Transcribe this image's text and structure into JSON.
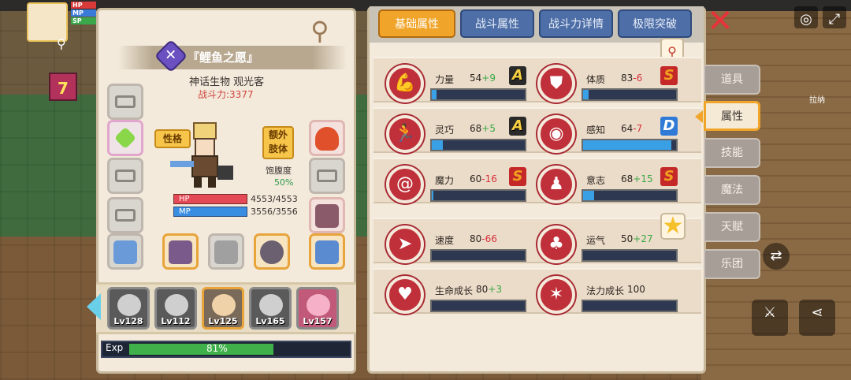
{
  "hud": {
    "hp_label": "HP",
    "mp_label": "MP",
    "sp_label": "SP",
    "level_badge": "7"
  },
  "left_panel": {
    "creature_name": "『鲤鱼之愿』",
    "creature_type": "神话生物 观光客",
    "power": "战斗力:3377",
    "personality_btn": "性格",
    "extra_limb_btn": "额外\n肢体",
    "satiety_label": "饱腹度",
    "satiety_value": "50%",
    "hp_label": "HP",
    "mp_label": "MP",
    "hp_value": "4553/4553",
    "mp_value": "3556/3556",
    "team": [
      {
        "level": "Lv128"
      },
      {
        "level": "Lv112"
      },
      {
        "level": "Lv125"
      },
      {
        "level": "Lv165"
      },
      {
        "level": "Lv157"
      }
    ],
    "exp_label": "Exp",
    "exp_value": "81%",
    "exp_fraction": 0.81
  },
  "right_panel": {
    "tabs": [
      {
        "label": "基础属性"
      },
      {
        "label": "战斗属性"
      },
      {
        "label": "战斗力详情"
      },
      {
        "label": "极限突破"
      }
    ],
    "stats": [
      {
        "name": "力量",
        "value": "54",
        "bonus": "+9",
        "grade": "A",
        "fill": 0.05,
        "icon": "muscle-icon"
      },
      {
        "name": "体质",
        "value": "83",
        "bonus": "-6",
        "grade": "S",
        "fill": 0.06,
        "icon": "body-icon"
      },
      {
        "name": "灵巧",
        "value": "68",
        "bonus": "+5",
        "grade": "A",
        "fill": 0.12,
        "icon": "running-icon"
      },
      {
        "name": "感知",
        "value": "64",
        "bonus": "-7",
        "grade": "D",
        "fill": 0.95,
        "icon": "eye-icon"
      },
      {
        "name": "魔力",
        "value": "60",
        "bonus": "-16",
        "grade": "S",
        "fill": 0.02,
        "icon": "swirl-icon"
      },
      {
        "name": "意志",
        "value": "68",
        "bonus": "+15",
        "grade": "S",
        "fill": 0.12,
        "icon": "will-icon"
      },
      {
        "name": "速度",
        "value": "80",
        "bonus": "-66",
        "grade": "",
        "fill": 0,
        "icon": "speed-icon"
      },
      {
        "name": "运气",
        "value": "50",
        "bonus": "+27",
        "grade": "",
        "fill": 0,
        "icon": "clover-icon"
      },
      {
        "name": "生命成长",
        "value": "80",
        "bonus": "+3",
        "grade": "",
        "fill": 0,
        "icon": "life-growth-icon"
      },
      {
        "name": "法力成长",
        "value": "100",
        "bonus": "",
        "grade": "",
        "fill": 0,
        "icon": "mana-growth-icon"
      }
    ]
  },
  "side_menu": [
    {
      "label": "道具"
    },
    {
      "label": "属性"
    },
    {
      "label": "技能"
    },
    {
      "label": "魔法"
    },
    {
      "label": "天赋"
    },
    {
      "label": "乐团"
    }
  ],
  "map_label": "拉纳"
}
